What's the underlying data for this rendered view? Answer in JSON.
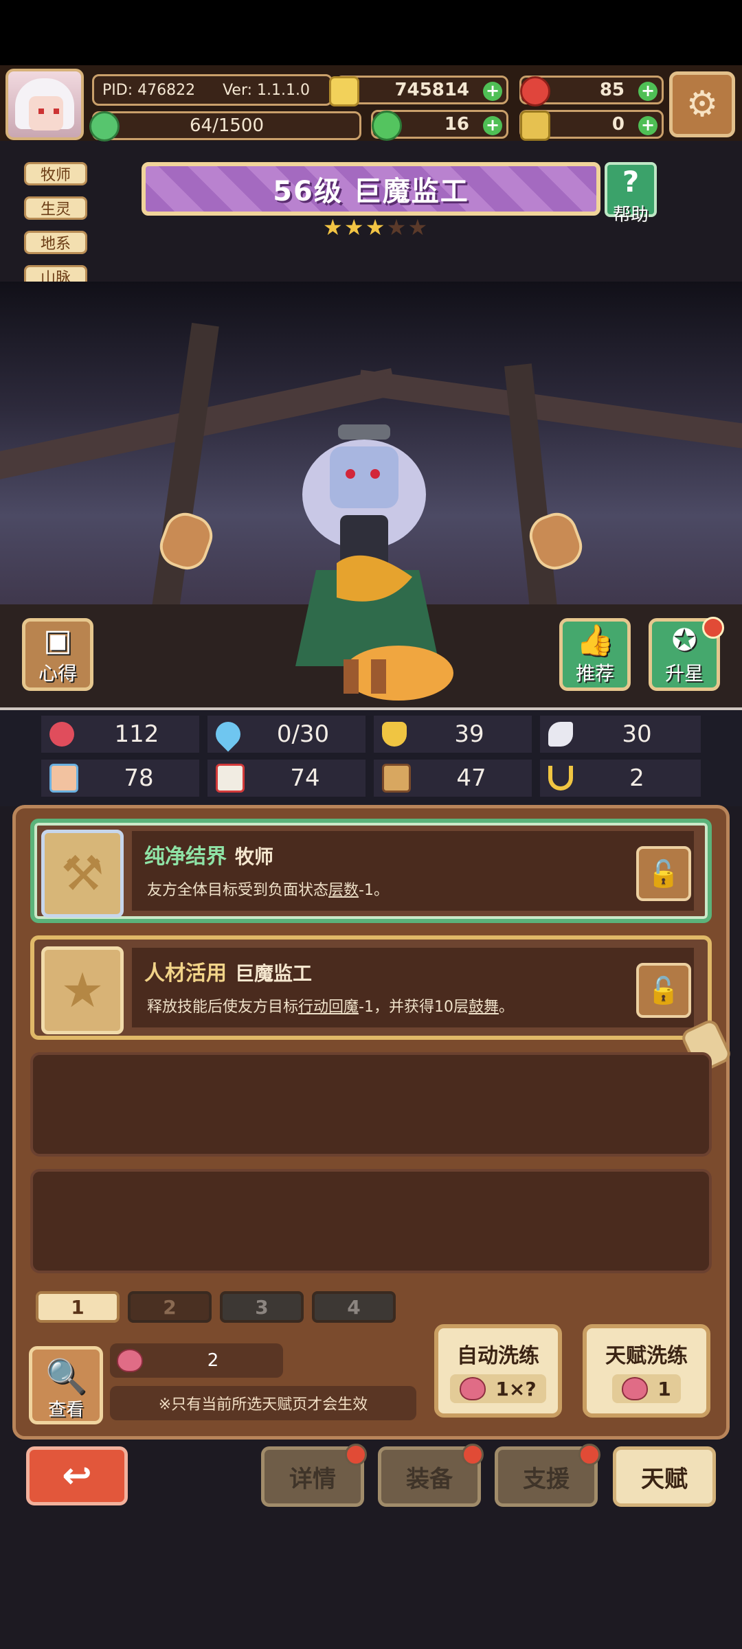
{
  "hud": {
    "pid": "PID: 476822",
    "version": "Ver: 1.1.1.0",
    "xp": "64/1500",
    "gold": "745814",
    "gems": "85",
    "clover": "16",
    "keys": "0"
  },
  "tags": [
    "牧师",
    "生灵",
    "地系",
    "山脉"
  ],
  "hero": {
    "title": "56级 巨魔监工",
    "stars": "★★★★★",
    "star_filled": 3,
    "star_total": 5,
    "help_label": "帮助"
  },
  "scene_buttons": {
    "insight": "心得",
    "recommend": "推荐",
    "star_up": "升星"
  },
  "stats": [
    {
      "icon": "heart-icon",
      "value": "112"
    },
    {
      "icon": "mana-drop-icon",
      "value": "0/30"
    },
    {
      "icon": "shield-icon",
      "value": "39"
    },
    {
      "icon": "wing-icon",
      "value": "30"
    },
    {
      "icon": "fist-icon",
      "value": "78"
    },
    {
      "icon": "book-icon",
      "value": "74"
    },
    {
      "icon": "armor-icon",
      "value": "47"
    },
    {
      "icon": "horseshoe-icon",
      "value": "2"
    }
  ],
  "talents": [
    {
      "name": "纯净结界",
      "class": "牧师",
      "desc_pre": "友方全体目标受到负面状态",
      "desc_link": "层数",
      "desc_post": "-1。"
    },
    {
      "name": "人材活用",
      "class": "巨魔监工",
      "desc_pre": "释放技能后使友方目标",
      "desc_link": "行动回魔",
      "desc_mid": "-1，并获得10层",
      "desc_link2": "鼓舞",
      "desc_post": "。"
    }
  ],
  "pages": [
    "1",
    "2",
    "3",
    "4"
  ],
  "bottom": {
    "view_label": "查看",
    "berry_count": "2",
    "note": "※只有当前所选天赋页才会生效",
    "auto_refine_label": "自动洗练",
    "auto_refine_cost": "1×?",
    "talent_refine_label": "天赋洗练",
    "talent_refine_cost": "1"
  },
  "nav": {
    "details": "详情",
    "equipment": "装备",
    "support": "支援",
    "talent": "天赋"
  },
  "colors": {
    "accent_green": "#3ba26a",
    "panel_brown": "#7b4b2d",
    "active_card_border": "#5bb37a",
    "gold_card_border": "#e0b968"
  }
}
